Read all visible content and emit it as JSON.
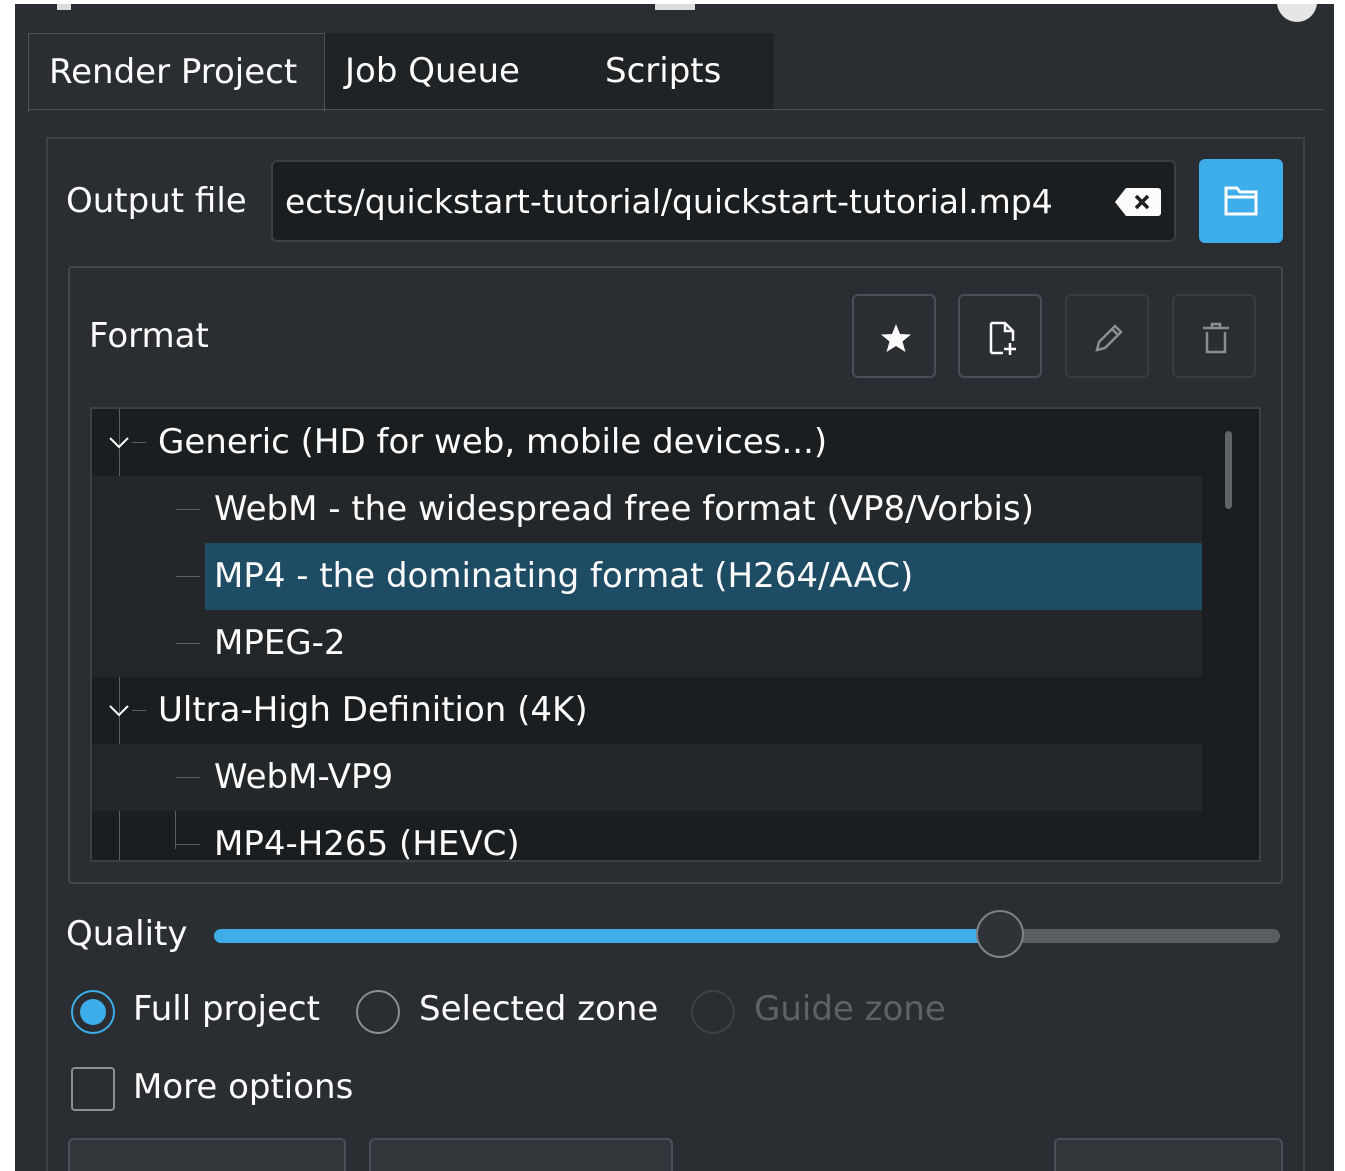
{
  "tabs": [
    {
      "label": "Render Project",
      "active": true
    },
    {
      "label": "Job Queue",
      "active": false
    },
    {
      "label": "Scripts",
      "active": false
    }
  ],
  "output": {
    "label": "Output file",
    "value": "ects/quickstart-tutorial/quickstart-tutorial.mp4",
    "clear_icon": "backspace-clear-icon",
    "browse_icon": "folder-icon"
  },
  "format": {
    "label": "Format",
    "toolbar_icons": [
      "star-icon",
      "new-document-icon",
      "edit-pencil-icon",
      "trash-icon"
    ],
    "tree": [
      {
        "label": "Generic (HD for web, mobile devices...)",
        "group": true,
        "expanded": true
      },
      {
        "label": "WebM - the widespread free format (VP8/Vorbis)"
      },
      {
        "label": "MP4 - the dominating format (H264/AAC)",
        "selected": true
      },
      {
        "label": "MPEG-2"
      },
      {
        "label": "Ultra-High Definition (4K)",
        "group": true,
        "expanded": true
      },
      {
        "label": "WebM-VP9"
      },
      {
        "label": "MP4-H265 (HEVC)"
      }
    ]
  },
  "quality": {
    "label": "Quality",
    "level_fraction": 0.73
  },
  "range": [
    {
      "label": "Full project",
      "checked": true,
      "enabled": true
    },
    {
      "label": "Selected zone",
      "checked": false,
      "enabled": true
    },
    {
      "label": "Guide zone",
      "checked": false,
      "enabled": false
    }
  ],
  "more_options": {
    "label": "More options",
    "checked": false
  },
  "colors": {
    "accent": "#3daee9",
    "selection": "#1d4c64",
    "background": "#2a2e32"
  }
}
